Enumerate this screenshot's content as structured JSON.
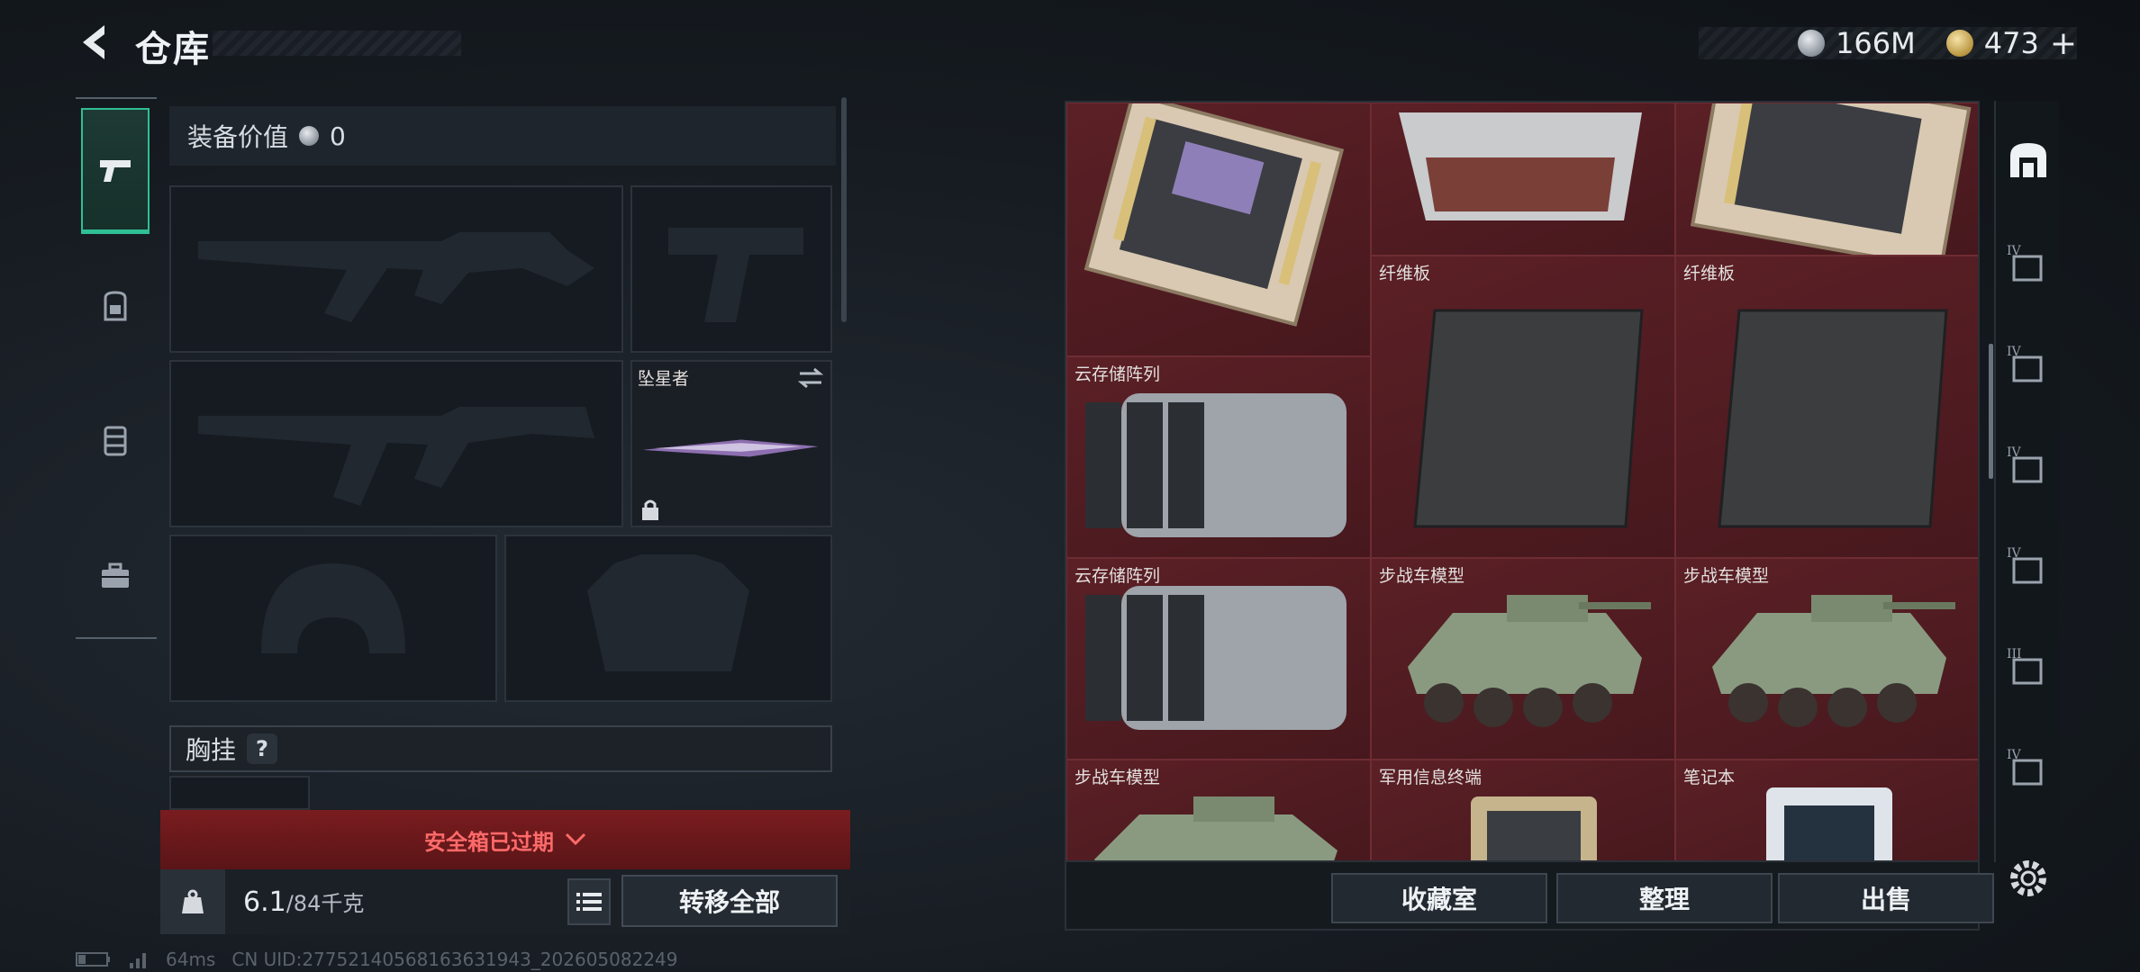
{
  "header": {
    "title": "仓库",
    "currency_silver": "166M",
    "currency_gold": "473",
    "gold_add": "+"
  },
  "equipment": {
    "value_label": "装备价值",
    "value": "0",
    "melee_name": "坠星者",
    "chest_rig_label": "胸挂",
    "chest_rig_help": "?",
    "safebox_status": "安全箱已过期",
    "weight_current": "6.1",
    "weight_max": "/84千克",
    "transfer_all": "转移全部"
  },
  "storage": {
    "items": [
      {
        "label": ""
      },
      {
        "label": ""
      },
      {
        "label": ""
      },
      {
        "label": "纤维板"
      },
      {
        "label": "纤维板"
      },
      {
        "label": "云存储阵列"
      },
      {
        "label": "云存储阵列"
      },
      {
        "label": "步战车模型"
      },
      {
        "label": "步战车模型"
      },
      {
        "label": "步战车模型"
      },
      {
        "label": "军用信息终端"
      },
      {
        "label": "笔记本"
      }
    ],
    "buttons": {
      "collection": "收藏室",
      "organize": "整理",
      "sell": "出售"
    }
  },
  "right_nav": {
    "tiers": [
      "IV",
      "IV",
      "IV",
      "IV",
      "III",
      "IV"
    ]
  },
  "status": {
    "ping": "64ms",
    "uid": "CN UID:27752140568163631943_202605082249"
  },
  "colors": {
    "accent": "#2fbf94",
    "cell_bg": "#5b2026",
    "warning": "#ff6a6a"
  }
}
